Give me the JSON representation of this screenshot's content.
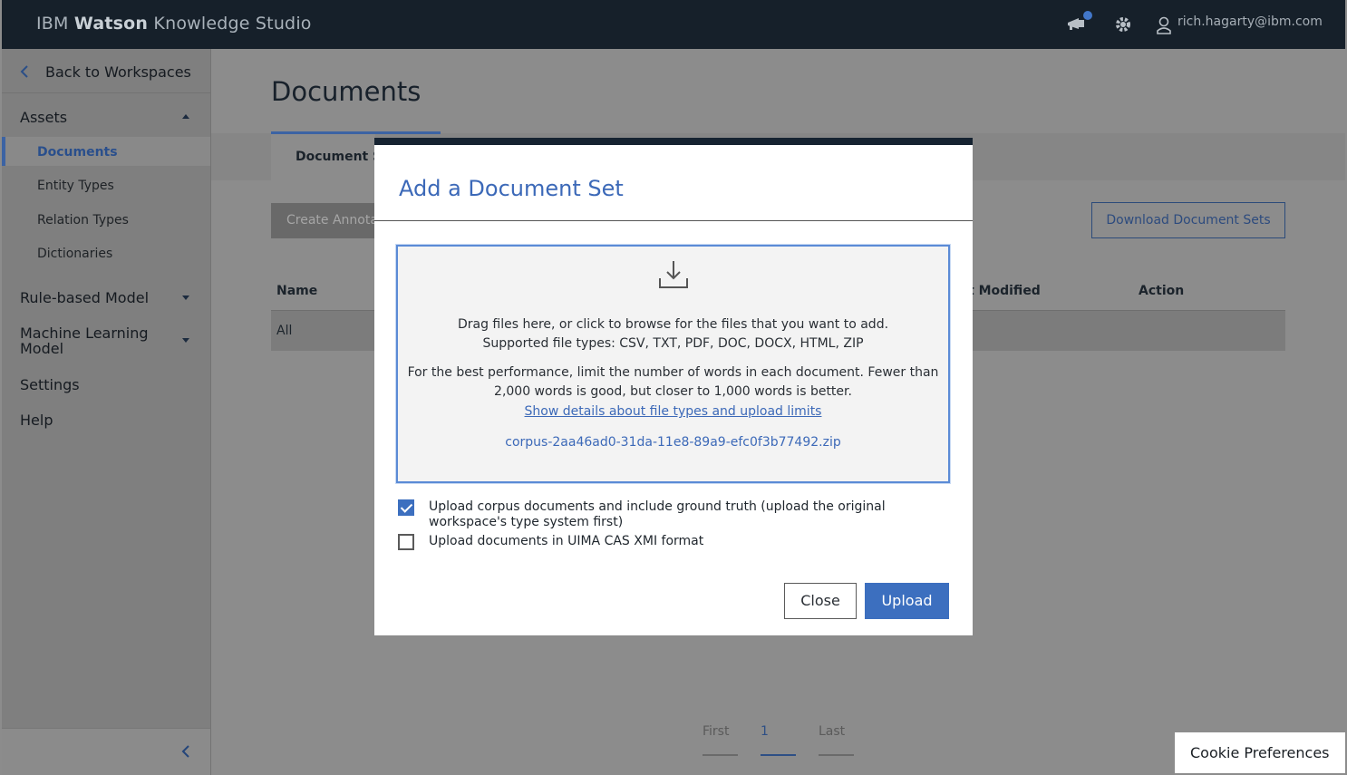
{
  "header": {
    "brand_prefix": "IBM",
    "brand_bold": "Watson",
    "brand_suffix": "Knowledge Studio",
    "user": "rich.hagarty@ibm.com"
  },
  "sidebar": {
    "back_label": "Back to Workspaces",
    "assets_label": "Assets",
    "asset_items": [
      "Documents",
      "Entity Types",
      "Relation Types",
      "Dictionaries"
    ],
    "active_item": "Documents",
    "rule_model_label": "Rule-based Model",
    "ml_model_label_1": "Machine Learning",
    "ml_model_label_2": "Model",
    "settings_label": "Settings",
    "help_label": "Help"
  },
  "main": {
    "title": "Documents",
    "tab_label": "Document S",
    "create_button": "Create Annota",
    "download_button": "Download Document Sets",
    "columns": {
      "name": "Name",
      "modified": "t Modified",
      "action": "Action"
    },
    "row_all": "All",
    "pager": {
      "first": "First",
      "current": "1",
      "last": "Last"
    }
  },
  "cookie_label": "Cookie Preferences",
  "modal": {
    "title": "Add a Document Set",
    "drop_line1": "Drag files here, or click to browse for the files that you want to add.",
    "drop_line2": "Supported file types: CSV, TXT, PDF, DOC, DOCX, HTML, ZIP",
    "perf_line1": "For the best performance, limit the number of words in each document. Fewer than",
    "perf_line2": "2,000 words is good, but closer to 1,000 words is better.",
    "details_link": "Show details about file types and upload limits",
    "selected_file": "corpus-2aa46ad0-31da-11e8-89a9-efc0f3b77492.zip",
    "option1_line1": "Upload corpus documents and include ground truth (upload the original",
    "option1_line2": "workspace's type system first)",
    "option1_checked": true,
    "option2": "Upload documents in UIMA CAS XMI format",
    "option2_checked": false,
    "close_button": "Close",
    "upload_button": "Upload"
  }
}
